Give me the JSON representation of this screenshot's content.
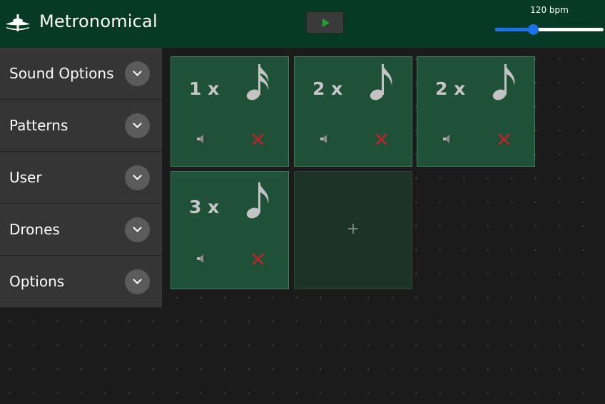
{
  "app": {
    "title": "Metronomical",
    "logo_icon": "cymbal-icon",
    "brand_color": "#063a27"
  },
  "transport": {
    "play_icon": "play-icon",
    "bpm_label": "120 bpm",
    "bpm_value": 120,
    "bpm_fraction": 0.35
  },
  "sidebar": {
    "items": [
      {
        "label": "Sound Options",
        "icon": "chevron-down-icon"
      },
      {
        "label": "Patterns",
        "icon": "chevron-down-icon"
      },
      {
        "label": "User",
        "icon": "chevron-down-icon"
      },
      {
        "label": "Drones",
        "icon": "chevron-down-icon"
      },
      {
        "label": "Options",
        "icon": "chevron-down-icon"
      }
    ]
  },
  "beats": [
    {
      "count": "1 x",
      "note": "sixteenth-note-icon",
      "mute_icon": "speaker-icon",
      "remove_icon": "close-icon"
    },
    {
      "count": "2 x",
      "note": "eighth-note-icon",
      "mute_icon": "speaker-icon",
      "remove_icon": "close-icon"
    },
    {
      "count": "2 x",
      "note": "eighth-note-icon",
      "mute_icon": "speaker-icon",
      "remove_icon": "close-icon"
    },
    {
      "count": "3 x",
      "note": "eighth-note-icon",
      "mute_icon": "speaker-icon",
      "remove_icon": "close-icon"
    }
  ],
  "add_beat": {
    "label": "+"
  },
  "colors": {
    "tile": "#1f5038",
    "remove": "#b3262a",
    "accent": "#1a73e8",
    "play": "#1fa32e"
  }
}
